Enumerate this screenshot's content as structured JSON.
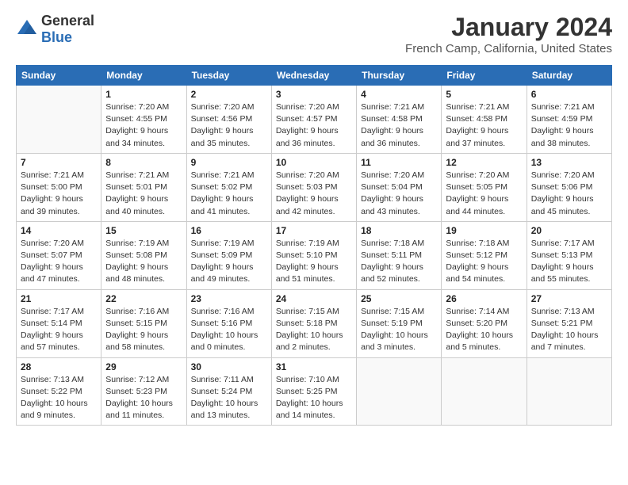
{
  "logo": {
    "general": "General",
    "blue": "Blue"
  },
  "title": "January 2024",
  "location": "French Camp, California, United States",
  "weekdays": [
    "Sunday",
    "Monday",
    "Tuesday",
    "Wednesday",
    "Thursday",
    "Friday",
    "Saturday"
  ],
  "weeks": [
    [
      {
        "day": "",
        "sunrise": "",
        "sunset": "",
        "daylight": ""
      },
      {
        "day": "1",
        "sunrise": "7:20 AM",
        "sunset": "4:55 PM",
        "daylight": "9 hours and 34 minutes."
      },
      {
        "day": "2",
        "sunrise": "7:20 AM",
        "sunset": "4:56 PM",
        "daylight": "9 hours and 35 minutes."
      },
      {
        "day": "3",
        "sunrise": "7:20 AM",
        "sunset": "4:57 PM",
        "daylight": "9 hours and 36 minutes."
      },
      {
        "day": "4",
        "sunrise": "7:21 AM",
        "sunset": "4:58 PM",
        "daylight": "9 hours and 36 minutes."
      },
      {
        "day": "5",
        "sunrise": "7:21 AM",
        "sunset": "4:58 PM",
        "daylight": "9 hours and 37 minutes."
      },
      {
        "day": "6",
        "sunrise": "7:21 AM",
        "sunset": "4:59 PM",
        "daylight": "9 hours and 38 minutes."
      }
    ],
    [
      {
        "day": "7",
        "sunrise": "7:21 AM",
        "sunset": "5:00 PM",
        "daylight": "9 hours and 39 minutes."
      },
      {
        "day": "8",
        "sunrise": "7:21 AM",
        "sunset": "5:01 PM",
        "daylight": "9 hours and 40 minutes."
      },
      {
        "day": "9",
        "sunrise": "7:21 AM",
        "sunset": "5:02 PM",
        "daylight": "9 hours and 41 minutes."
      },
      {
        "day": "10",
        "sunrise": "7:20 AM",
        "sunset": "5:03 PM",
        "daylight": "9 hours and 42 minutes."
      },
      {
        "day": "11",
        "sunrise": "7:20 AM",
        "sunset": "5:04 PM",
        "daylight": "9 hours and 43 minutes."
      },
      {
        "day": "12",
        "sunrise": "7:20 AM",
        "sunset": "5:05 PM",
        "daylight": "9 hours and 44 minutes."
      },
      {
        "day": "13",
        "sunrise": "7:20 AM",
        "sunset": "5:06 PM",
        "daylight": "9 hours and 45 minutes."
      }
    ],
    [
      {
        "day": "14",
        "sunrise": "7:20 AM",
        "sunset": "5:07 PM",
        "daylight": "9 hours and 47 minutes."
      },
      {
        "day": "15",
        "sunrise": "7:19 AM",
        "sunset": "5:08 PM",
        "daylight": "9 hours and 48 minutes."
      },
      {
        "day": "16",
        "sunrise": "7:19 AM",
        "sunset": "5:09 PM",
        "daylight": "9 hours and 49 minutes."
      },
      {
        "day": "17",
        "sunrise": "7:19 AM",
        "sunset": "5:10 PM",
        "daylight": "9 hours and 51 minutes."
      },
      {
        "day": "18",
        "sunrise": "7:18 AM",
        "sunset": "5:11 PM",
        "daylight": "9 hours and 52 minutes."
      },
      {
        "day": "19",
        "sunrise": "7:18 AM",
        "sunset": "5:12 PM",
        "daylight": "9 hours and 54 minutes."
      },
      {
        "day": "20",
        "sunrise": "7:17 AM",
        "sunset": "5:13 PM",
        "daylight": "9 hours and 55 minutes."
      }
    ],
    [
      {
        "day": "21",
        "sunrise": "7:17 AM",
        "sunset": "5:14 PM",
        "daylight": "9 hours and 57 minutes."
      },
      {
        "day": "22",
        "sunrise": "7:16 AM",
        "sunset": "5:15 PM",
        "daylight": "9 hours and 58 minutes."
      },
      {
        "day": "23",
        "sunrise": "7:16 AM",
        "sunset": "5:16 PM",
        "daylight": "10 hours and 0 minutes."
      },
      {
        "day": "24",
        "sunrise": "7:15 AM",
        "sunset": "5:18 PM",
        "daylight": "10 hours and 2 minutes."
      },
      {
        "day": "25",
        "sunrise": "7:15 AM",
        "sunset": "5:19 PM",
        "daylight": "10 hours and 3 minutes."
      },
      {
        "day": "26",
        "sunrise": "7:14 AM",
        "sunset": "5:20 PM",
        "daylight": "10 hours and 5 minutes."
      },
      {
        "day": "27",
        "sunrise": "7:13 AM",
        "sunset": "5:21 PM",
        "daylight": "10 hours and 7 minutes."
      }
    ],
    [
      {
        "day": "28",
        "sunrise": "7:13 AM",
        "sunset": "5:22 PM",
        "daylight": "10 hours and 9 minutes."
      },
      {
        "day": "29",
        "sunrise": "7:12 AM",
        "sunset": "5:23 PM",
        "daylight": "10 hours and 11 minutes."
      },
      {
        "day": "30",
        "sunrise": "7:11 AM",
        "sunset": "5:24 PM",
        "daylight": "10 hours and 13 minutes."
      },
      {
        "day": "31",
        "sunrise": "7:10 AM",
        "sunset": "5:25 PM",
        "daylight": "10 hours and 14 minutes."
      },
      {
        "day": "",
        "sunrise": "",
        "sunset": "",
        "daylight": ""
      },
      {
        "day": "",
        "sunrise": "",
        "sunset": "",
        "daylight": ""
      },
      {
        "day": "",
        "sunrise": "",
        "sunset": "",
        "daylight": ""
      }
    ]
  ],
  "labels": {
    "sunrise_prefix": "Sunrise: ",
    "sunset_prefix": "Sunset: ",
    "daylight_prefix": "Daylight: "
  }
}
